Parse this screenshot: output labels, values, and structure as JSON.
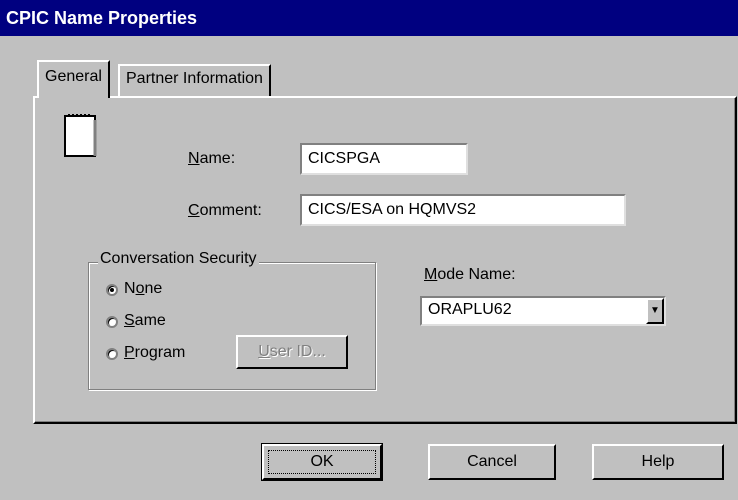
{
  "window": {
    "title": "CPIC Name Properties"
  },
  "tabs": [
    {
      "label": "General",
      "active": true
    },
    {
      "label": "Partner Information",
      "active": false
    }
  ],
  "general": {
    "icon": "document-icon",
    "name_label_u": "N",
    "name_label_rest": "ame:",
    "name_value": "CICSPGA",
    "comment_label_u": "C",
    "comment_label_rest": "omment:",
    "comment_value": "CICS/ESA on HQMVS2"
  },
  "security": {
    "title": "Conversation Security",
    "options": [
      {
        "pre": "N",
        "u": "o",
        "post": "ne",
        "checked": true
      },
      {
        "pre": "",
        "u": "S",
        "post": "ame",
        "checked": false
      },
      {
        "pre": "",
        "u": "P",
        "post": "rogram",
        "checked": false
      }
    ],
    "userid_u": "U",
    "userid_rest": "ser ID..."
  },
  "mode": {
    "label_u": "M",
    "label_rest": "ode Name:",
    "value": "ORAPLU62"
  },
  "buttons": {
    "ok": "OK",
    "cancel": "Cancel",
    "help": "Help"
  }
}
